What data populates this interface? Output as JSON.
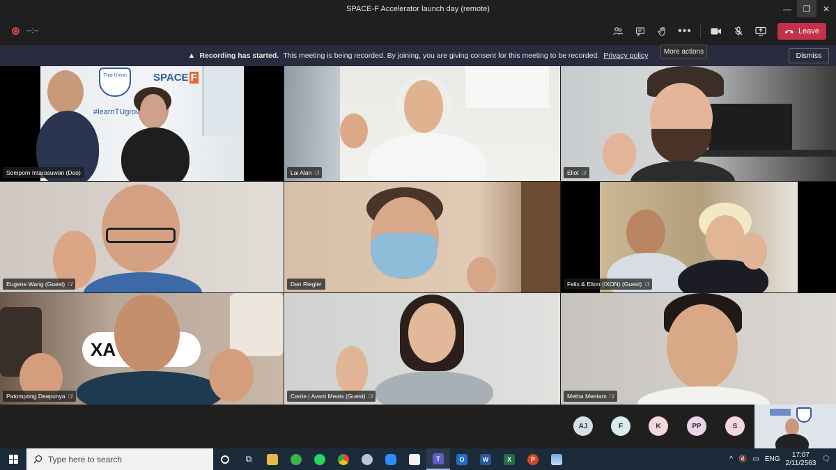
{
  "window": {
    "title": "SPACE-F Accelerator launch day (remote)"
  },
  "toolbar": {
    "timer": "--:--",
    "leave_label": "Leave",
    "more_actions_tooltip": "More actions"
  },
  "banner": {
    "title": "Recording has started.",
    "message": "This meeting is being recorded. By joining, you are giving consent for this meeting to be recorded.",
    "link": "Privacy policy",
    "dismiss_label": "Dismiss"
  },
  "participants": [
    {
      "name": "Somporn Intarasuwan (Dao)"
    },
    {
      "name": "Lai Alan"
    },
    {
      "name": "Eliot"
    },
    {
      "name": "Eugene Wang (Guest)"
    },
    {
      "name": "Dan Riegler"
    },
    {
      "name": "Felix & Elton (IXON) (Guest)"
    },
    {
      "name": "Patompong Deepunya"
    },
    {
      "name": "Carrie | Avant Meats (Guest)"
    },
    {
      "name": "Metha Meetam"
    }
  ],
  "tile1_signage": {
    "brand": "Thai Union",
    "slogan": "#learnTUgrow",
    "logo": "SPACE"
  },
  "tile7_sign": {
    "text": "XA"
  },
  "avatars": [
    {
      "initials": "AJ",
      "color": "#d5dfe8"
    },
    {
      "initials": "F",
      "color": "#d8ecee"
    },
    {
      "initials": "K",
      "color": "#f3d9dc"
    },
    {
      "initials": "PP",
      "color": "#ecd3ea"
    },
    {
      "initials": "S",
      "color": "#f5d6dc"
    }
  ],
  "taskbar": {
    "search_placeholder": "Type here to search",
    "language": "ENG",
    "time": "17:07",
    "date": "2/11/2563"
  },
  "colors": {
    "leave": "#c4314b",
    "banner": "#2b2b3f",
    "taskbar": "#1c2b3a"
  }
}
